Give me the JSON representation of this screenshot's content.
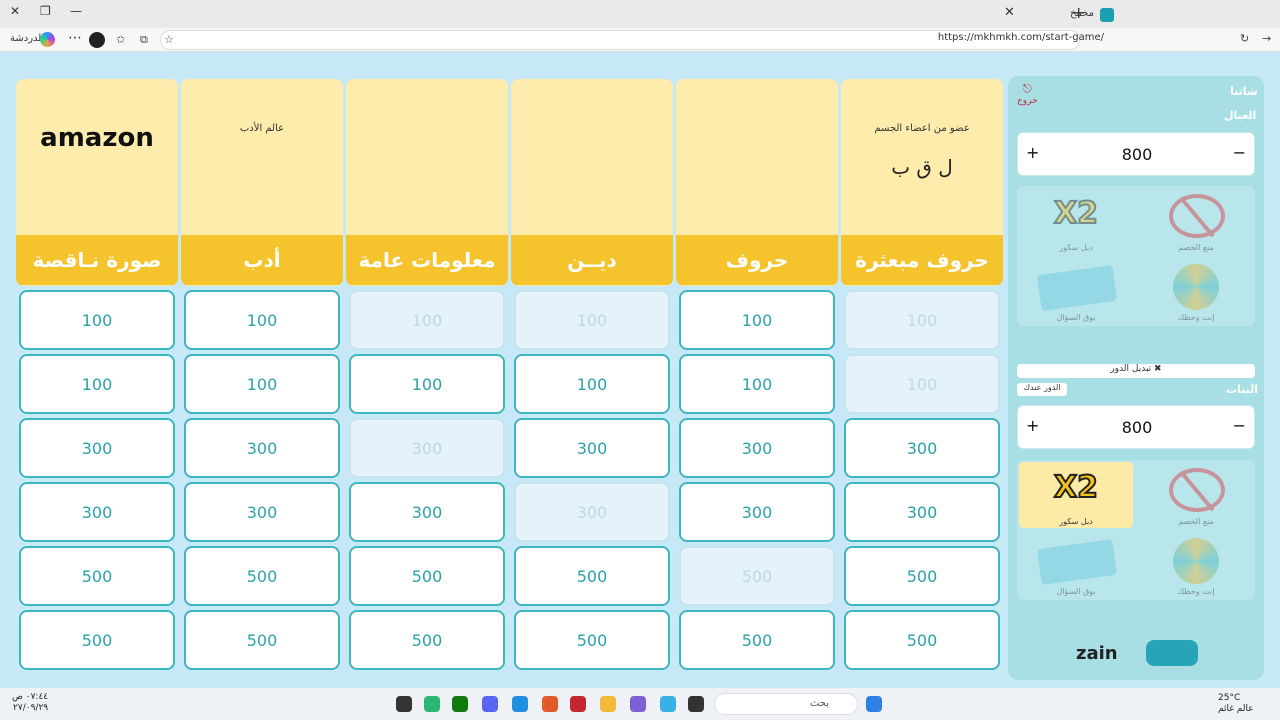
{
  "browser": {
    "tab_title": "مخمخ",
    "url": "https://mkhmkh.com/start-game/",
    "chat_label": "الدردشة"
  },
  "categories": [
    {
      "name": "حروف مبعثرة",
      "image": "scrambled-letters-image",
      "caption": "عضو من اعضاء الجسم",
      "letters": "ل ق ب"
    },
    {
      "name": "حروف",
      "image": "letter-grid-image"
    },
    {
      "name": "ديــن",
      "image": "kaaba-image"
    },
    {
      "name": "معلومات عامة",
      "image": "general-info-image"
    },
    {
      "name": "أدب",
      "image": "scroll-quill-image",
      "caption": "عالم الأدب"
    },
    {
      "name": "صورة نـاقصة",
      "image": "amazon-logo-image",
      "caption": "amazon"
    }
  ],
  "board": [
    [
      "100",
      "100",
      "100",
      "100",
      "100",
      "100"
    ],
    [
      "100",
      "100",
      "100",
      "100",
      "100",
      "100"
    ],
    [
      "300",
      "300",
      "300",
      "300",
      "300",
      "300"
    ],
    [
      "300",
      "300",
      "300",
      "300",
      "300",
      "300"
    ],
    [
      "500",
      "500",
      "500",
      "500",
      "500",
      "500"
    ],
    [
      "500",
      "500",
      "500",
      "500",
      "500",
      "500"
    ]
  ],
  "used": [
    [
      true,
      false,
      true,
      true,
      false,
      false
    ],
    [
      true,
      false,
      false,
      false,
      false,
      false
    ],
    [
      false,
      false,
      false,
      true,
      false,
      false
    ],
    [
      false,
      false,
      true,
      false,
      false,
      false
    ],
    [
      false,
      true,
      false,
      false,
      false,
      false
    ],
    [
      false,
      false,
      false,
      false,
      false,
      false
    ]
  ],
  "sidebar": {
    "game_name": "شاتنا",
    "exit_label": "خروج",
    "team1": {
      "name": "العيال",
      "score": "800",
      "plus": "+",
      "minus": "−"
    },
    "team2": {
      "name": "البنات",
      "score": "800",
      "plus": "+",
      "minus": "−",
      "turn_badge": "الدور عندك"
    },
    "switch_turn": "تبديل الدور",
    "tools": {
      "ban": "منع الخصم",
      "double": "دبل سكور",
      "wheel": "إنت وحظك",
      "cards": "بوق السؤال"
    },
    "sponsor": "zain"
  },
  "taskbar": {
    "search_placeholder": "بحث",
    "time": "٠٧:٤٤ ص",
    "date": "٢٧/٠٩/٢٩",
    "weather_temp": "25°C",
    "weather_label": "عالم غائم"
  },
  "colors": {
    "accent": "#3eb6bf",
    "label_bg": "#f5c42c",
    "page_bg": "#c7e9f7",
    "sidebar_bg": "#a7dfe5"
  }
}
